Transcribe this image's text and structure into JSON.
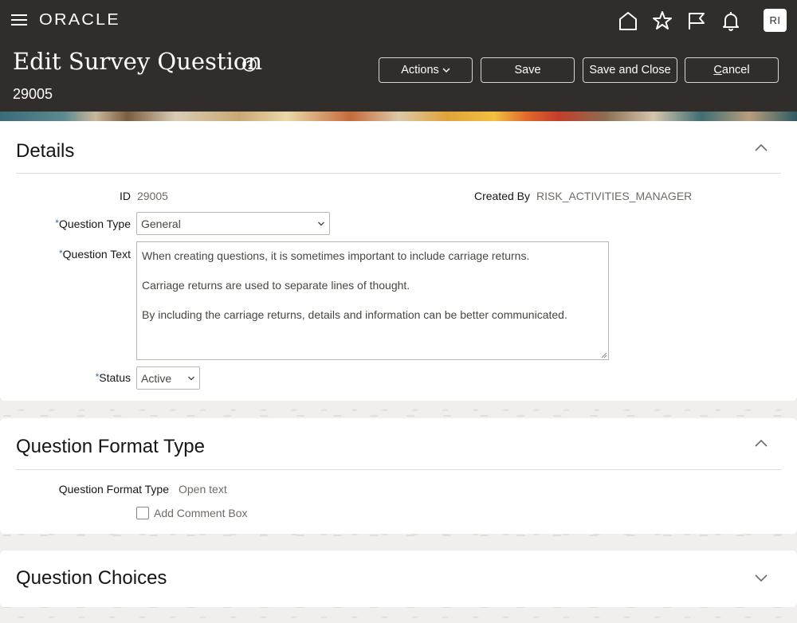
{
  "app": {
    "logo": "ORACLE",
    "avatar_initials": "RI"
  },
  "header": {
    "title": "Edit Survey Question",
    "subtitle": "29005",
    "buttons": {
      "actions": "Actions",
      "save": "Save",
      "save_close": "Save and Close",
      "cancel": "Cancel"
    }
  },
  "details": {
    "title": "Details",
    "id_label": "ID",
    "id_value": "29005",
    "created_by_label": "Created By",
    "created_by_value": "RISK_ACTIVITIES_MANAGER",
    "question_type_label": "Question Type",
    "question_type_value": "General",
    "question_text_label": "Question Text",
    "question_text_lines": [
      "When creating questions, it is sometimes important to include carriage returns.",
      "Carriage returns are used to separate lines of thought.",
      "By including the carriage returns, details and information can be better communicated."
    ],
    "status_label": "Status",
    "status_value": "Active",
    "required_marker": "*"
  },
  "format": {
    "title": "Question Format Type",
    "format_type_label": "Question Format Type",
    "format_type_value": "Open text",
    "add_comment_label": "Add Comment Box",
    "add_comment_checked": false
  },
  "choices": {
    "title": "Question Choices"
  },
  "icons": {
    "menu": "hamburger-icon",
    "home": "home-icon",
    "favorites": "star-icon",
    "flag": "flag-icon",
    "notifications": "bell-icon",
    "help": "help-icon"
  }
}
